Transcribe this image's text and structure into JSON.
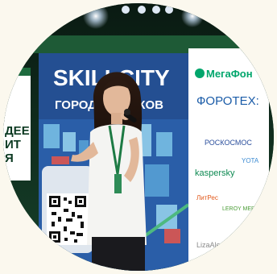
{
  "photo": {
    "shape": "circle",
    "background": "#fbf8ee",
    "left_screen": {
      "title_line1": "SKILLCITY",
      "title_line2": "ГОРОД НАВЫКОВ",
      "side_text": [
        "ДЕЕ",
        "ИТ",
        "Я"
      ]
    },
    "sponsors": [
      "МегаФон",
      "ФОРОТЕХ:",
      "РОСКОСМОС",
      "YOTA",
      "kaspersky",
      "ЛитРес",
      "LEROY MERLIN",
      "LizaAlert"
    ],
    "colors": {
      "stage_green": "#123a24",
      "screen_blue": "#2a5ea8",
      "megafon_green": "#00a66c",
      "shirt": "#f4f4f2"
    }
  }
}
